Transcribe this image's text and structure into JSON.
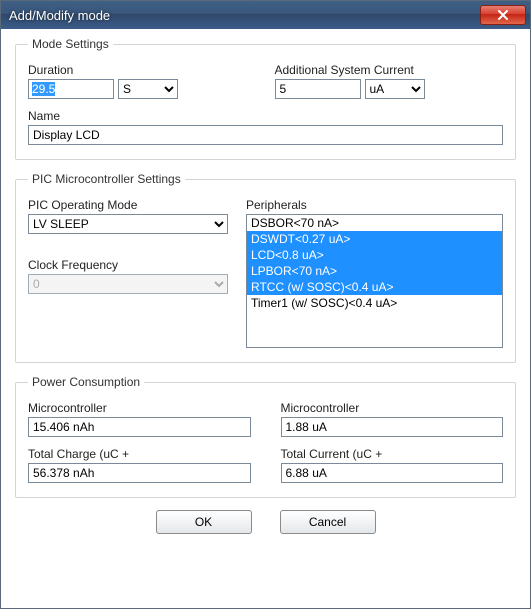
{
  "window": {
    "title": "Add/Modify mode"
  },
  "mode_settings": {
    "legend": "Mode Settings",
    "duration_label": "Duration",
    "duration_value": "29.5",
    "duration_unit": "S",
    "additional_current_label": "Additional System Current",
    "additional_current_value": "5",
    "additional_current_unit": "uA",
    "name_label": "Name",
    "name_value": "Display LCD"
  },
  "pic": {
    "legend": "PIC Microcontroller Settings",
    "operating_mode_label": "PIC Operating Mode",
    "operating_mode_value": "LV SLEEP",
    "clock_freq_label": "Clock Frequency",
    "clock_freq_value": "0",
    "clock_freq_enabled": false,
    "peripherals_label": "Peripherals",
    "peripherals": [
      {
        "text": "DSBOR<70 nA>",
        "selected": false
      },
      {
        "text": "DSWDT<0.27 uA>",
        "selected": true
      },
      {
        "text": "LCD<0.8 uA>",
        "selected": true
      },
      {
        "text": "LPBOR<70 nA>",
        "selected": true
      },
      {
        "text": "RTCC (w/ SOSC)<0.4 uA>",
        "selected": true
      },
      {
        "text": "Timer1 (w/ SOSC)<0.4 uA>",
        "selected": false
      }
    ]
  },
  "power": {
    "legend": "Power Consumption",
    "uc_charge_label": "Microcontroller",
    "uc_charge_value": "15.406 nAh",
    "uc_current_label": "Microcontroller",
    "uc_current_value": "1.88 uA",
    "total_charge_label": "Total Charge (uC +",
    "total_charge_value": "56.378 nAh",
    "total_current_label": "Total Current (uC +",
    "total_current_value": "6.88 uA"
  },
  "buttons": {
    "ok": "OK",
    "cancel": "Cancel"
  }
}
